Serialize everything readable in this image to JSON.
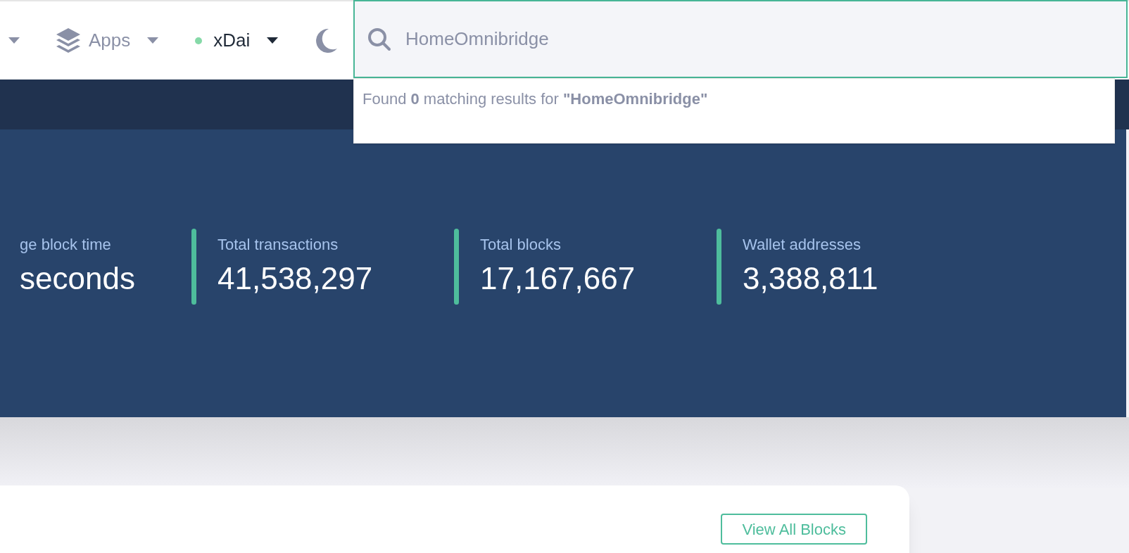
{
  "nav": [
    {
      "kind": "caret"
    },
    {
      "kind": "menu",
      "label": "Apps"
    },
    {
      "kind": "network",
      "label": "xDai",
      "color": "#86d9a8"
    },
    {
      "kind": "theme"
    }
  ],
  "search": {
    "value": "HomeOmnibridge",
    "result": "Found **0** matching results for **\"HomeOmnibridge\"**"
  },
  "stats": [
    {
      "label": "ge block time",
      "value": "seconds"
    },
    {
      "label": "Total transactions",
      "value": "41,538,297"
    },
    {
      "label": "Total blocks",
      "value": "17,167,667"
    },
    {
      "label": "Wallet addresses",
      "value": "3,388,811"
    }
  ],
  "card": {
    "button": "View All Blocks"
  }
}
